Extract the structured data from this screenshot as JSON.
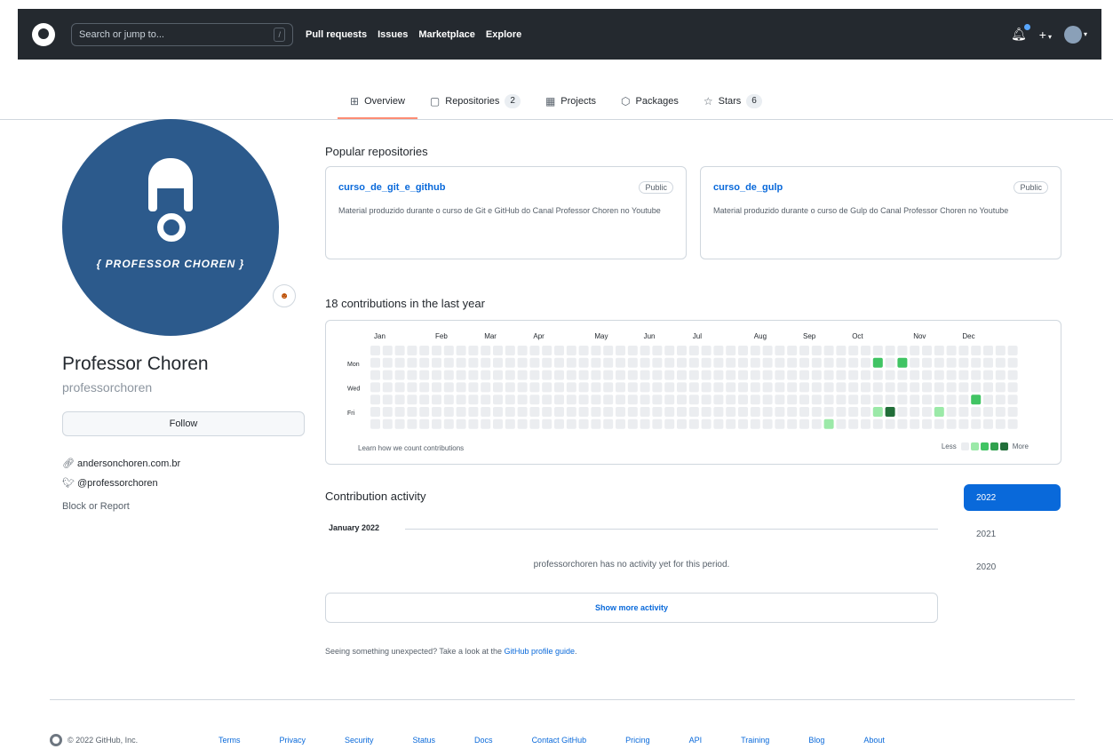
{
  "header": {
    "search_placeholder": "Search or jump to...",
    "slash_key": "/",
    "nav": [
      "Pull requests",
      "Issues",
      "Marketplace",
      "Explore"
    ],
    "plus": "+",
    "caret": "▾",
    "colors": {
      "bg": "#24292f",
      "notification_dot": "#58a6ff"
    }
  },
  "tabs": [
    {
      "label": "Overview",
      "icon": "book-icon",
      "glyph": "⊞",
      "selected": true,
      "count": ""
    },
    {
      "label": "Repositories",
      "icon": "repo-icon",
      "glyph": "▢",
      "selected": false,
      "count": "2"
    },
    {
      "label": "Projects",
      "icon": "project-icon",
      "glyph": "▦",
      "selected": false,
      "count": ""
    },
    {
      "label": "Packages",
      "icon": "package-icon",
      "glyph": "⬡",
      "selected": false,
      "count": ""
    },
    {
      "label": "Stars",
      "icon": "star-icon",
      "glyph": "☆",
      "selected": false,
      "count": "6"
    }
  ],
  "profile": {
    "avatar_text": "{ PROFESSOR CHOREN }",
    "status_emoji": "☻",
    "name": "Professor Choren",
    "login": "professorchoren",
    "follow_label": "Follow",
    "website": "andersonchoren.com.br",
    "twitter": "@professorchoren",
    "block_report": "Block or Report"
  },
  "popular": {
    "title": "Popular repositories",
    "repos": [
      {
        "name": "curso_de_git_e_github",
        "visibility": "Public",
        "description": "Material produzido durante o curso de Git e GitHub do Canal Professor Choren no Youtube"
      },
      {
        "name": "curso_de_gulp",
        "visibility": "Public",
        "description": "Material produzido durante o curso de Gulp do Canal Professor Choren no Youtube"
      }
    ]
  },
  "contributions": {
    "title": "18 contributions in the last year",
    "months": [
      "Jan",
      "Feb",
      "Mar",
      "Apr",
      "May",
      "Jun",
      "Jul",
      "Aug",
      "Sep",
      "Oct",
      "Nov",
      "Dec"
    ],
    "days": [
      "Mon",
      "Wed",
      "Fri"
    ],
    "learn": "Learn how we count contributions",
    "legend_less": "Less",
    "legend_more": "More",
    "level_colors": [
      "#ebedf0",
      "#9be9a8",
      "#40c463",
      "#30a14e",
      "#216e39"
    ],
    "active_cells": [
      {
        "week": 41,
        "day": 1,
        "level": 2
      },
      {
        "week": 41,
        "day": 5,
        "level": 1
      },
      {
        "week": 42,
        "day": 5,
        "level": 4
      },
      {
        "week": 43,
        "day": 1,
        "level": 2
      },
      {
        "week": 37,
        "day": 6,
        "level": 1
      },
      {
        "week": 46,
        "day": 5,
        "level": 1
      },
      {
        "week": 49,
        "day": 4,
        "level": 2
      }
    ]
  },
  "activity": {
    "title": "Contribution activity",
    "month": "January 2022",
    "empty": "professorchoren has no activity yet for this period.",
    "show_more": "Show more activity",
    "years": [
      "2022",
      "2021",
      "2020"
    ],
    "unexpected_prefix": "Seeing something unexpected? Take a look at the ",
    "unexpected_link": "GitHub profile guide",
    "unexpected_suffix": "."
  },
  "footer": {
    "copyright": "© 2022 GitHub, Inc.",
    "links": [
      "Terms",
      "Privacy",
      "Security",
      "Status",
      "Docs",
      "Contact GitHub",
      "Pricing",
      "API",
      "Training",
      "Blog",
      "About"
    ]
  }
}
